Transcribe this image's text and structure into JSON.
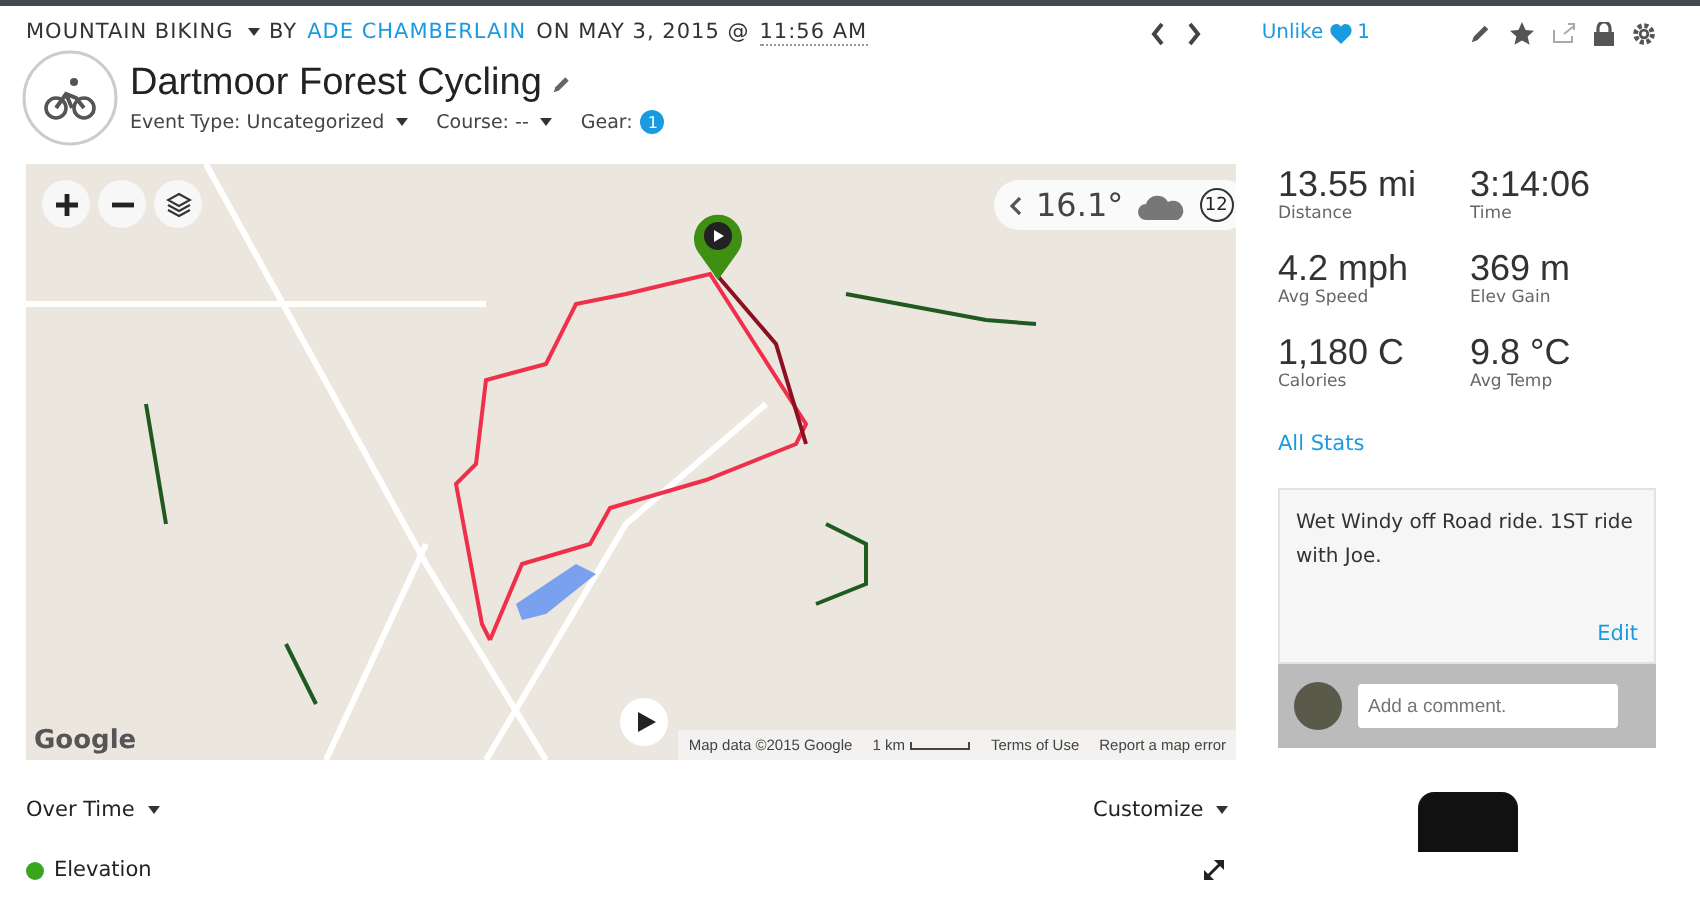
{
  "header": {
    "category": "MOUNTAIN BIKING",
    "by": "BY",
    "author": "ADE CHAMBERLAIN",
    "on": "ON MAY 3, 2015 @",
    "time": "11:56 AM",
    "like_label": "Unlike",
    "like_count": "1"
  },
  "title": "Dartmoor Forest Cycling",
  "meta": [
    {
      "label": "Event Type: Uncategorized",
      "kind": "dropdown"
    },
    {
      "label": "Course: --",
      "kind": "dropdown"
    },
    {
      "label": "Gear:",
      "kind": "badge",
      "badge": "1"
    }
  ],
  "map": {
    "weather": {
      "temperature": "16.1°",
      "hour": "12"
    },
    "attribution": [
      {
        "text": "Map data ©2015 Google",
        "kind": "text"
      },
      {
        "text": "1 km",
        "kind": "scale"
      },
      {
        "text": "Terms of Use",
        "kind": "link"
      },
      {
        "text": "Report a map error",
        "kind": "link"
      }
    ],
    "logo": "Google"
  },
  "stats": [
    {
      "value": "13.55 mi",
      "label": "Distance"
    },
    {
      "value": "3:14:06",
      "label": "Time"
    },
    {
      "value": "4.2 mph",
      "label": "Avg Speed"
    },
    {
      "value": "369 m",
      "label": "Elev Gain"
    },
    {
      "value": "1,180 C",
      "label": "Calories"
    },
    {
      "value": "9.8 °C",
      "label": "Avg Temp"
    }
  ],
  "all_stats": "All Stats",
  "note": {
    "text": "Wet Windy off Road ride. 1ST ride with Joe.",
    "edit": "Edit",
    "comment_placeholder": "Add a comment."
  },
  "chart_controls": {
    "view": "Over Time",
    "customize": "Customize"
  },
  "legend": [
    {
      "label": "Elevation",
      "color": "#3aa61f"
    }
  ]
}
